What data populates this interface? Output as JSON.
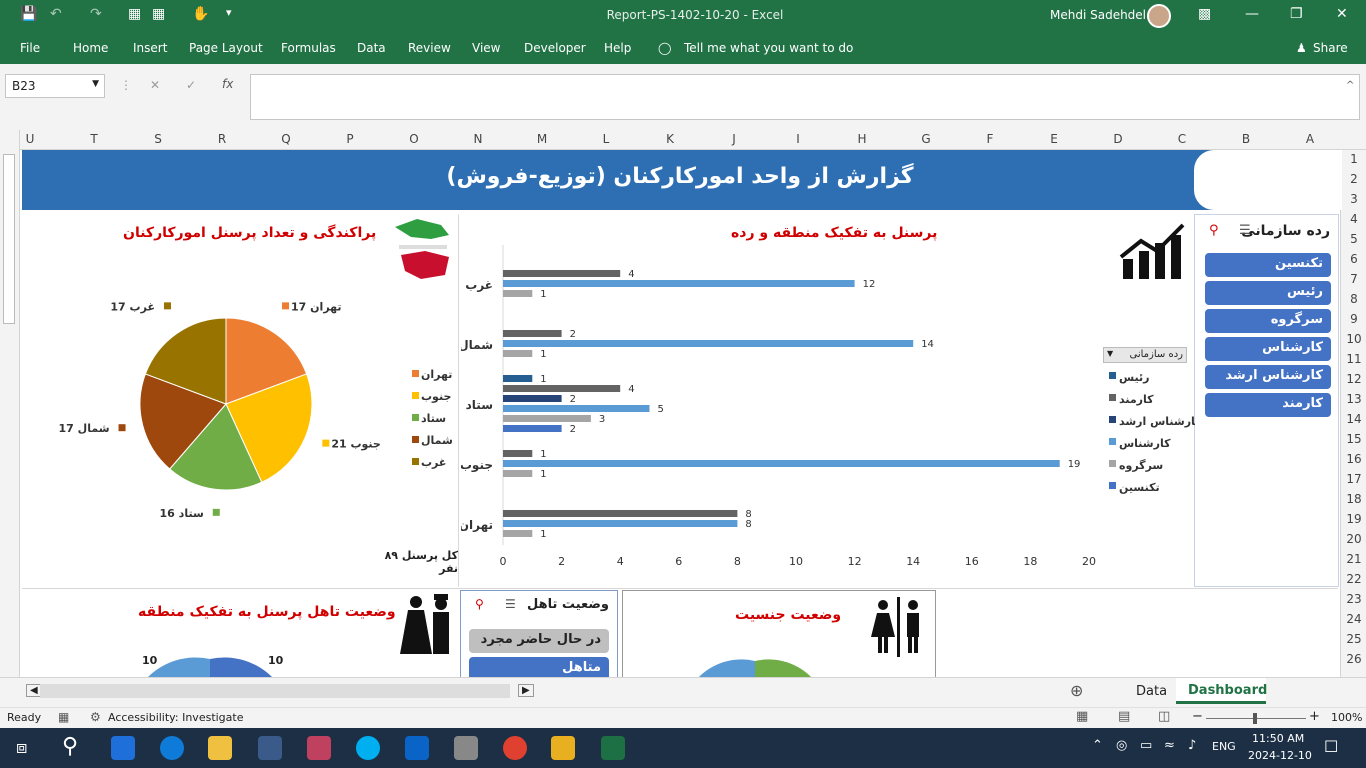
{
  "window": {
    "title": "Report-PS-1402-10-20  -  Excel",
    "user": "Mehdi Sadehdel"
  },
  "menu": [
    "File",
    "Home",
    "Insert",
    "Page Layout",
    "Formulas",
    "Data",
    "Review",
    "View",
    "Developer",
    "Help",
    "Tell me what you want to do",
    "Share"
  ],
  "formula_bar": {
    "name_box": "B23",
    "formula": ""
  },
  "columns": [
    "U",
    "T",
    "S",
    "R",
    "Q",
    "P",
    "O",
    "N",
    "M",
    "L",
    "K",
    "J",
    "I",
    "H",
    "G",
    "F",
    "E",
    "D",
    "C",
    "B",
    "A"
  ],
  "rows": [
    "1",
    "2",
    "3",
    "4",
    "5",
    "6",
    "7",
    "8",
    "9",
    "10",
    "11",
    "12",
    "13",
    "14",
    "15",
    "16",
    "17",
    "18",
    "19",
    "20",
    "21",
    "22",
    "23",
    "24",
    "25",
    "26"
  ],
  "dashboard": {
    "title": "گزارش از واحد امورکارکنان (توزیع-فروش)",
    "slicer_title": "رده سازمانی",
    "slicer_items": [
      "تکنسین",
      "رئیس",
      "سرگروه",
      "کارشناس",
      "کارشناس ارشد",
      "کارمند"
    ],
    "bar_title": "پرسنل به تفکیک منطقه و رده",
    "filter_label": "رده سازمانی",
    "pie_title": "پراکندگی و تعداد پرسنل امورکارکنان",
    "total_label": "کل پرسنل ۸۹ نفر",
    "marital_title": "وضعیت تاهل پرسنل به تفکیک منطقه",
    "marital_slicer_title": "وضعیت تاهل",
    "marital_items": [
      "در حال حاضر مجرد",
      "متاهل"
    ],
    "gender_title": "وضعیت جنسیت",
    "marital_pie_labels": [
      "10",
      "10"
    ]
  },
  "chart_data": [
    {
      "type": "bar",
      "orientation": "horizontal",
      "title": "پرسنل به تفکیک منطقه و رده",
      "categories": [
        "غرب",
        "شمال",
        "ستاد",
        "جنوب",
        "تهران"
      ],
      "xlim": [
        0,
        20
      ],
      "xticks": [
        "0",
        "2",
        "4",
        "6",
        "8",
        "10",
        "12",
        "14",
        "16",
        "18",
        "20"
      ],
      "series": [
        {
          "name": "رئیس",
          "color": "#255e91",
          "values": [
            0,
            0,
            1,
            0,
            0
          ]
        },
        {
          "name": "کارمند",
          "color": "#636363",
          "values": [
            4,
            2,
            4,
            1,
            8
          ]
        },
        {
          "name": "کارشناس ارشد",
          "color": "#264478",
          "values": [
            0,
            0,
            2,
            0,
            0
          ]
        },
        {
          "name": "کارشناس",
          "color": "#5b9bd5",
          "values": [
            12,
            14,
            5,
            19,
            8
          ]
        },
        {
          "name": "سرگروه",
          "color": "#a5a5a5",
          "values": [
            1,
            1,
            3,
            1,
            1
          ]
        },
        {
          "name": "تکنسین",
          "color": "#4472c4",
          "values": [
            0,
            0,
            2,
            0,
            0
          ]
        }
      ]
    },
    {
      "type": "pie",
      "title": "پراکندگی و تعداد پرسنل امورکارکنان",
      "labels": [
        "تهران",
        "جنوب",
        "ستاد",
        "شمال",
        "غرب"
      ],
      "values": [
        17,
        21,
        16,
        17,
        17
      ],
      "colors": [
        "#ed7d31",
        "#ffc000",
        "#70ad47",
        "#9e480e",
        "#997300"
      ],
      "data_labels": [
        "تهران 17",
        "جنوب 21",
        "ستاد 16",
        "شمال 17",
        "غرب 17"
      ]
    }
  ],
  "sheet_tabs": [
    "Data",
    "Dashboard"
  ],
  "status": {
    "ready": "Ready",
    "accessibility": "Accessibility: Investigate",
    "zoom": "100%"
  },
  "taskbar": {
    "lang": "ENG",
    "time": "11:50 AM",
    "date": "2024-12-10"
  }
}
